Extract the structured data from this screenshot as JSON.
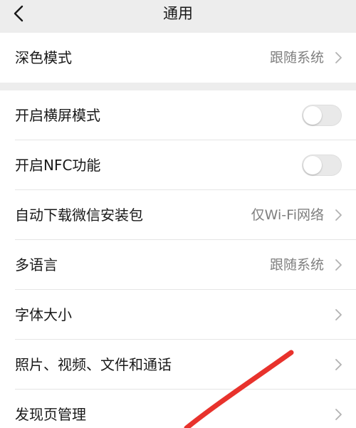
{
  "nav": {
    "title": "通用",
    "back_icon": "chevron-left-icon"
  },
  "settings": {
    "dark_mode": {
      "label": "深色模式",
      "value": "跟随系统"
    },
    "landscape": {
      "label": "开启横屏模式",
      "enabled": false
    },
    "nfc": {
      "label": "开启NFC功能",
      "enabled": false
    },
    "auto_download": {
      "label": "自动下载微信安装包",
      "value": "仅Wi-Fi网络"
    },
    "language": {
      "label": "多语言",
      "value": "跟随系统"
    },
    "font_size": {
      "label": "字体大小"
    },
    "media": {
      "label": "照片、视频、文件和通话"
    },
    "discover": {
      "label": "发现页管理"
    }
  },
  "colors": {
    "background": "#ededed",
    "row_background": "#ffffff",
    "primary_text": "#191919",
    "secondary_text": "#7f7f7f",
    "toggle_off": "#e9e9e9",
    "annotation_stroke": "#e8322c"
  }
}
